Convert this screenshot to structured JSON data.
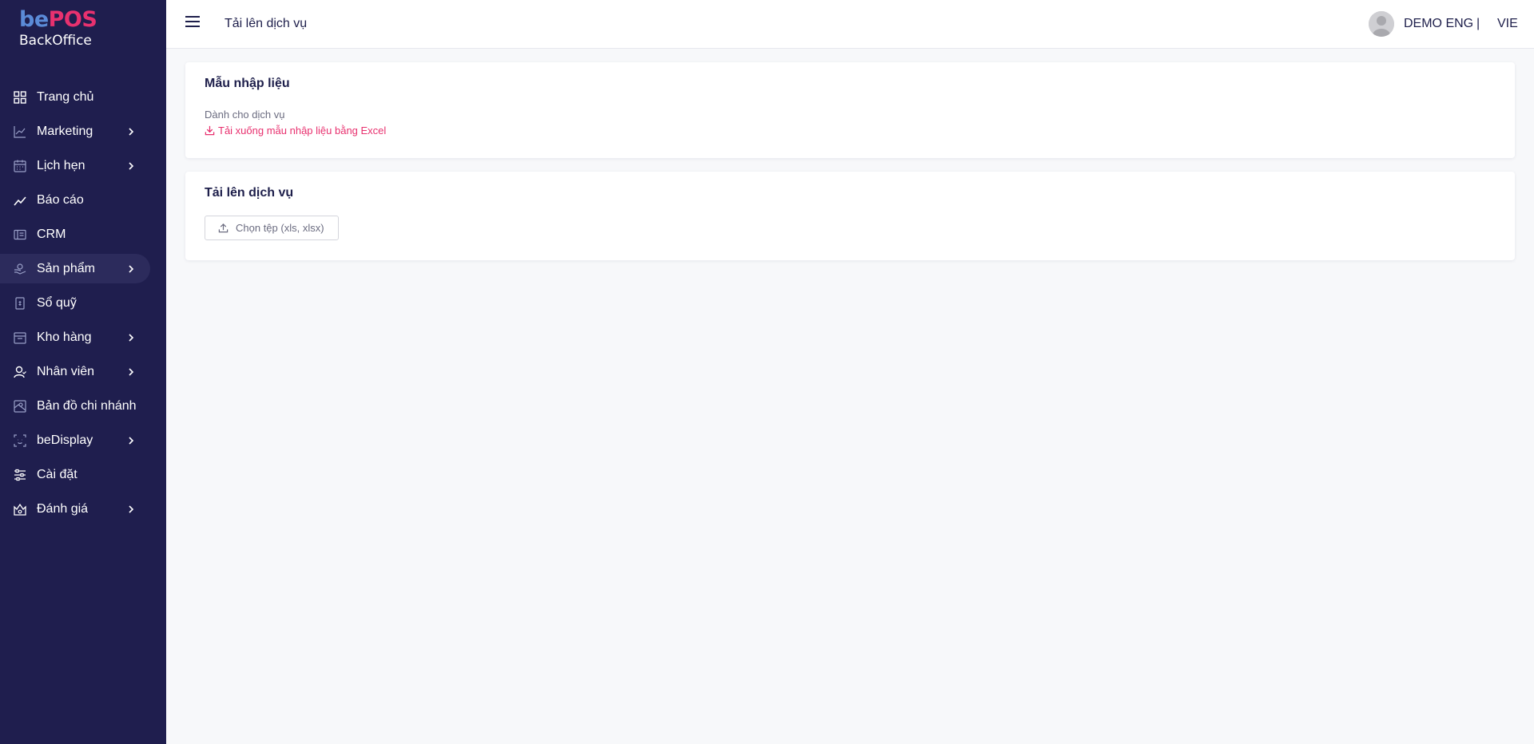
{
  "logo": {
    "be": "be",
    "pos": "POS",
    "sub": "BackOffice"
  },
  "sidebar": {
    "items": [
      {
        "label": "Trang chủ",
        "icon": "grid-icon",
        "chevron": false,
        "active": false
      },
      {
        "label": "Marketing",
        "icon": "trend-chart-icon",
        "chevron": true,
        "active": false
      },
      {
        "label": "Lịch hẹn",
        "icon": "calendar-icon",
        "chevron": true,
        "active": false
      },
      {
        "label": "Báo cáo",
        "icon": "line-chart-icon",
        "chevron": false,
        "active": false
      },
      {
        "label": "CRM",
        "icon": "id-card-icon",
        "chevron": false,
        "active": false
      },
      {
        "label": "Sản phẩm",
        "icon": "product-icon",
        "chevron": true,
        "active": true
      },
      {
        "label": "Sổ quỹ",
        "icon": "cashbook-icon",
        "chevron": false,
        "active": false
      },
      {
        "label": "Kho hàng",
        "icon": "warehouse-icon",
        "chevron": true,
        "active": false
      },
      {
        "label": "Nhân viên",
        "icon": "staff-icon",
        "chevron": true,
        "active": false
      },
      {
        "label": "Bản đồ chi nhánh",
        "icon": "map-icon",
        "chevron": false,
        "active": false
      },
      {
        "label": "beDisplay",
        "icon": "display-scan-icon",
        "chevron": true,
        "active": false
      },
      {
        "label": "Cài đặt",
        "icon": "settings-sliders-icon",
        "chevron": false,
        "active": false
      },
      {
        "label": "Đánh giá",
        "icon": "rating-icon",
        "chevron": true,
        "active": false
      }
    ]
  },
  "header": {
    "title": "Tải lên dịch vụ",
    "user_name": "DEMO ENG",
    "separator": "|",
    "language": "VIE"
  },
  "template_card": {
    "title": "Mẫu nhập liệu",
    "subtitle": "Dành cho dịch vụ",
    "download_label": "Tải xuống mẫu nhập liệu bằng Excel"
  },
  "upload_card": {
    "title": "Tải lên dịch vụ",
    "button_label": "Chọn tệp (xls, xlsx)"
  },
  "colors": {
    "sidebar_bg": "#1f1e4e",
    "accent_pink": "#e8316f",
    "logo_blue": "#5b8bd8",
    "page_bg": "#f7f8fa"
  }
}
